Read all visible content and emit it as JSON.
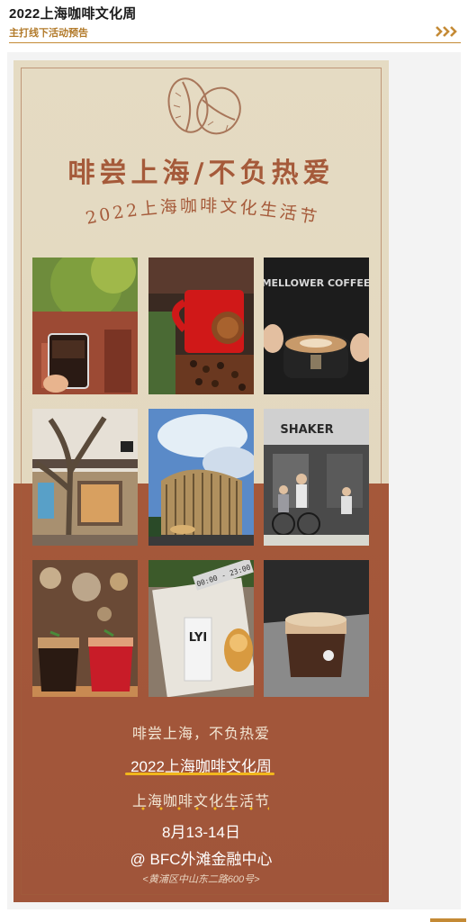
{
  "header": {
    "title": "2022上海咖啡文化周",
    "subtitle": "主打线下活动预告",
    "chevron_icon": "chevron-triple-right-icon",
    "accent_color": "#c48a35"
  },
  "poster": {
    "headline": "啡尝上海/不负热爱",
    "festival": "2022上海咖啡文化生活节",
    "photos": [
      {
        "name": "iced-coffee-street"
      },
      {
        "name": "red-mug-beans"
      },
      {
        "name": "mellower-coffee-latte",
        "sign": "MELLOWER COFFEE"
      },
      {
        "name": "cafe-building-tree"
      },
      {
        "name": "bfc-building"
      },
      {
        "name": "shaker-cafe-terrace",
        "sign": "SHAKER"
      },
      {
        "name": "two-iced-drinks"
      },
      {
        "name": "oat-milk-croissant",
        "carton_text": "LYI",
        "tag_text": "00:00 - 23:00"
      },
      {
        "name": "latte-cup-counter"
      }
    ],
    "tagline": "啡尝上海，不负热爱",
    "week_title": "2022上海咖啡文化周",
    "life_fest": "上海咖啡文化生活节",
    "date": "8月13-14日",
    "venue": "@ BFC外滩金融中心",
    "address": "<黄浦区中山东二路600号>",
    "colors": {
      "cream": "#e5dbc3",
      "brown": "#a5583a",
      "gold": "#f2b71c"
    }
  }
}
